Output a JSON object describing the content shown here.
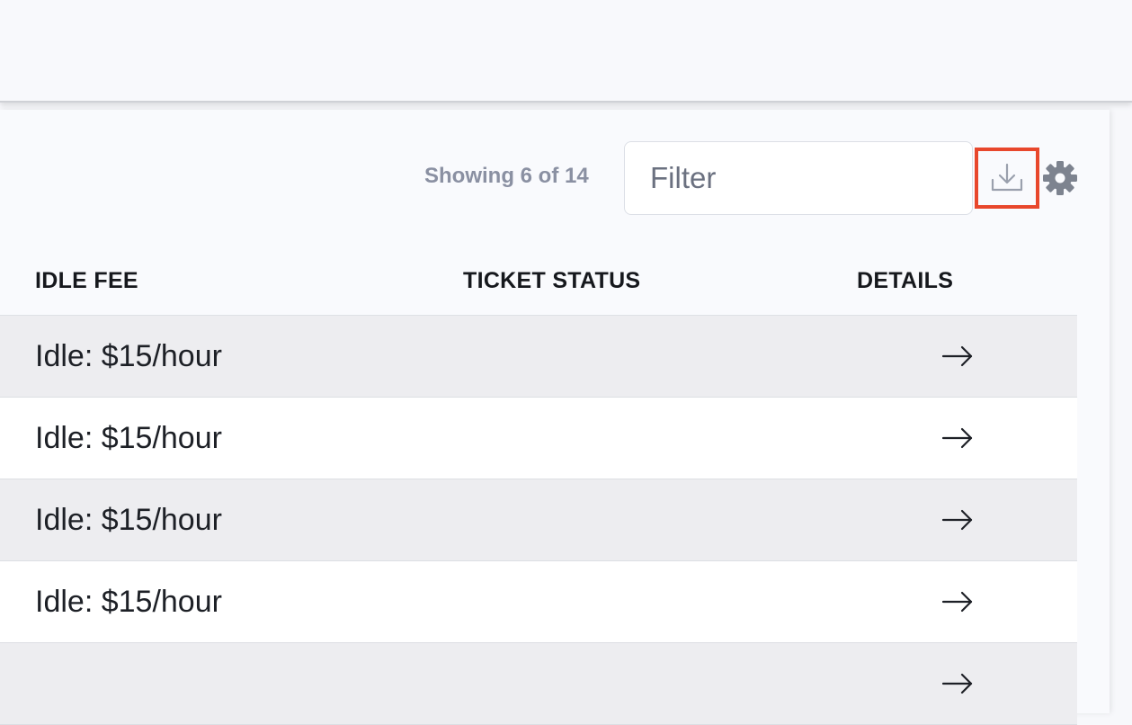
{
  "toolbar": {
    "count_text": "Showing 6 of 14",
    "filter_placeholder": "Filter",
    "filter_value": "",
    "download_icon": "download-icon",
    "settings_icon": "gear-icon",
    "highlight_color": "#e8472c"
  },
  "table": {
    "columns": [
      "IDLE FEE",
      "TICKET STATUS",
      "DETAILS"
    ],
    "rows": [
      {
        "idle_fee": "Idle: $15/hour",
        "ticket_status": "",
        "details_icon": "arrow-right-icon"
      },
      {
        "idle_fee": "Idle: $15/hour",
        "ticket_status": "",
        "details_icon": "arrow-right-icon"
      },
      {
        "idle_fee": "Idle: $15/hour",
        "ticket_status": "",
        "details_icon": "arrow-right-icon"
      },
      {
        "idle_fee": "Idle: $15/hour",
        "ticket_status": "",
        "details_icon": "arrow-right-icon"
      },
      {
        "idle_fee": "",
        "ticket_status": "",
        "details_icon": "arrow-right-icon"
      }
    ]
  }
}
